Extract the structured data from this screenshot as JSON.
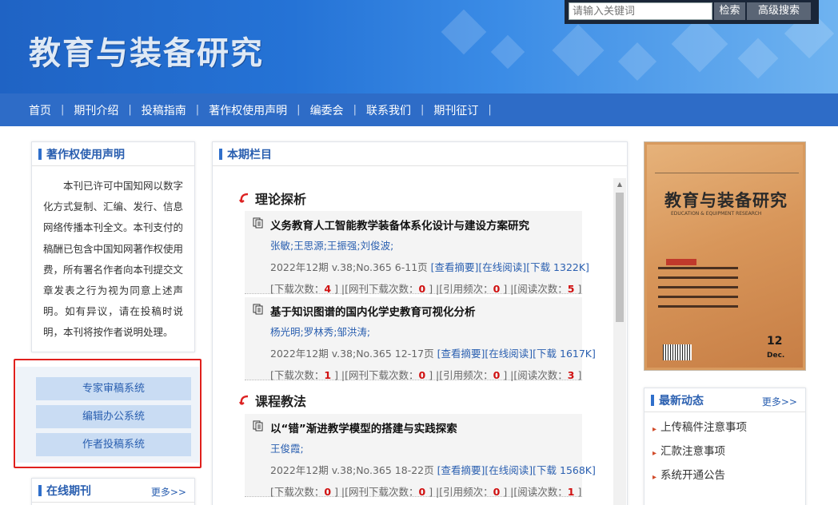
{
  "header": {
    "site_title": "教育与装备研究",
    "search_placeholder": "请输入关键词",
    "search_button": "检索",
    "advanced_search_button": "高级搜索"
  },
  "nav": {
    "items": [
      "首页",
      "期刊介绍",
      "投稿指南",
      "著作权使用声明",
      "编委会",
      "联系我们",
      "期刊征订"
    ]
  },
  "copyright_box": {
    "title": "著作权使用声明",
    "text": "本刊已许可中国知网以数字化方式复制、汇编、发行、信息网络传播本刊全文。本刊支付的稿酬已包含中国知网著作权使用费，所有署名作者向本刊提交文章发表之行为视为同意上述声明。如有异议，请在投稿时说明，本刊将按作者说明处理。"
  },
  "systems": {
    "expert_review": "专家审稿系统",
    "editor_office": "编辑办公系统",
    "author_submission": "作者投稿系统"
  },
  "online_journal": {
    "title": "在线期刊",
    "more": "更多>>"
  },
  "current_issue": {
    "title": "本期栏目",
    "sections": [
      {
        "name": "理论探析",
        "articles": [
          {
            "title": "义务教育人工智能教学装备体系化设计与建设方案研究",
            "authors": "张敏;王思源;王振强;刘俊波;",
            "issue": "2022年12期 v.38;No.365 6-11页",
            "abstract_link": "[查看摘要]",
            "read_link": "[在线阅读]",
            "download_link": "[下载 1322K]",
            "stats_downloads_label": "[下载次数：",
            "stats_downloads": "4",
            "stats_cnki_label": " ] |[网刊下载次数：",
            "stats_cnki": "0",
            "stats_cite_label": " ] |[引用频次：",
            "stats_cite": "0",
            "stats_read_label": " ] |[阅读次数：",
            "stats_read": "5",
            "stats_end": " ]"
          },
          {
            "title": "基于知识图谱的国内化学史教育可视化分析",
            "authors": "杨光明;罗林秀;邹洪涛;",
            "issue": "2022年12期 v.38;No.365 12-17页",
            "abstract_link": "[查看摘要]",
            "read_link": "[在线阅读]",
            "download_link": "[下载 1617K]",
            "stats_downloads_label": "[下载次数：",
            "stats_downloads": "1",
            "stats_cnki_label": " ] |[网刊下载次数：",
            "stats_cnki": "0",
            "stats_cite_label": " ] |[引用频次：",
            "stats_cite": "0",
            "stats_read_label": " ] |[阅读次数：",
            "stats_read": "3",
            "stats_end": " ]"
          }
        ]
      },
      {
        "name": "课程教法",
        "articles": [
          {
            "title": "以“错”渐进教学模型的搭建与实践探索",
            "authors": "王俊霞;",
            "issue": "2022年12期 v.38;No.365 18-22页",
            "abstract_link": "[查看摘要]",
            "read_link": "[在线阅读]",
            "download_link": "[下载 1568K]",
            "stats_downloads_label": "[下载次数：",
            "stats_downloads": "0",
            "stats_cnki_label": " ] |[网刊下载次数：",
            "stats_cnki": "0",
            "stats_cite_label": " ] |[引用频次：",
            "stats_cite": "0",
            "stats_read_label": " ] |[阅读次数：",
            "stats_read": "1",
            "stats_end": " ]"
          }
        ]
      }
    ]
  },
  "cover": {
    "title": "教育与装备研究",
    "subtitle": "EDUCATION & EQUIPMENT RESEARCH",
    "issue_no": "12",
    "issue_month": "Dec."
  },
  "news": {
    "title": "最新动态",
    "more": "更多>>",
    "items": [
      "上传稿件注意事项",
      "汇款注意事项",
      "系统开通公告"
    ]
  },
  "colors": {
    "brand_blue": "#2e6cc7",
    "link_blue": "#2a5fb0",
    "highlight_red": "#e0201d"
  }
}
